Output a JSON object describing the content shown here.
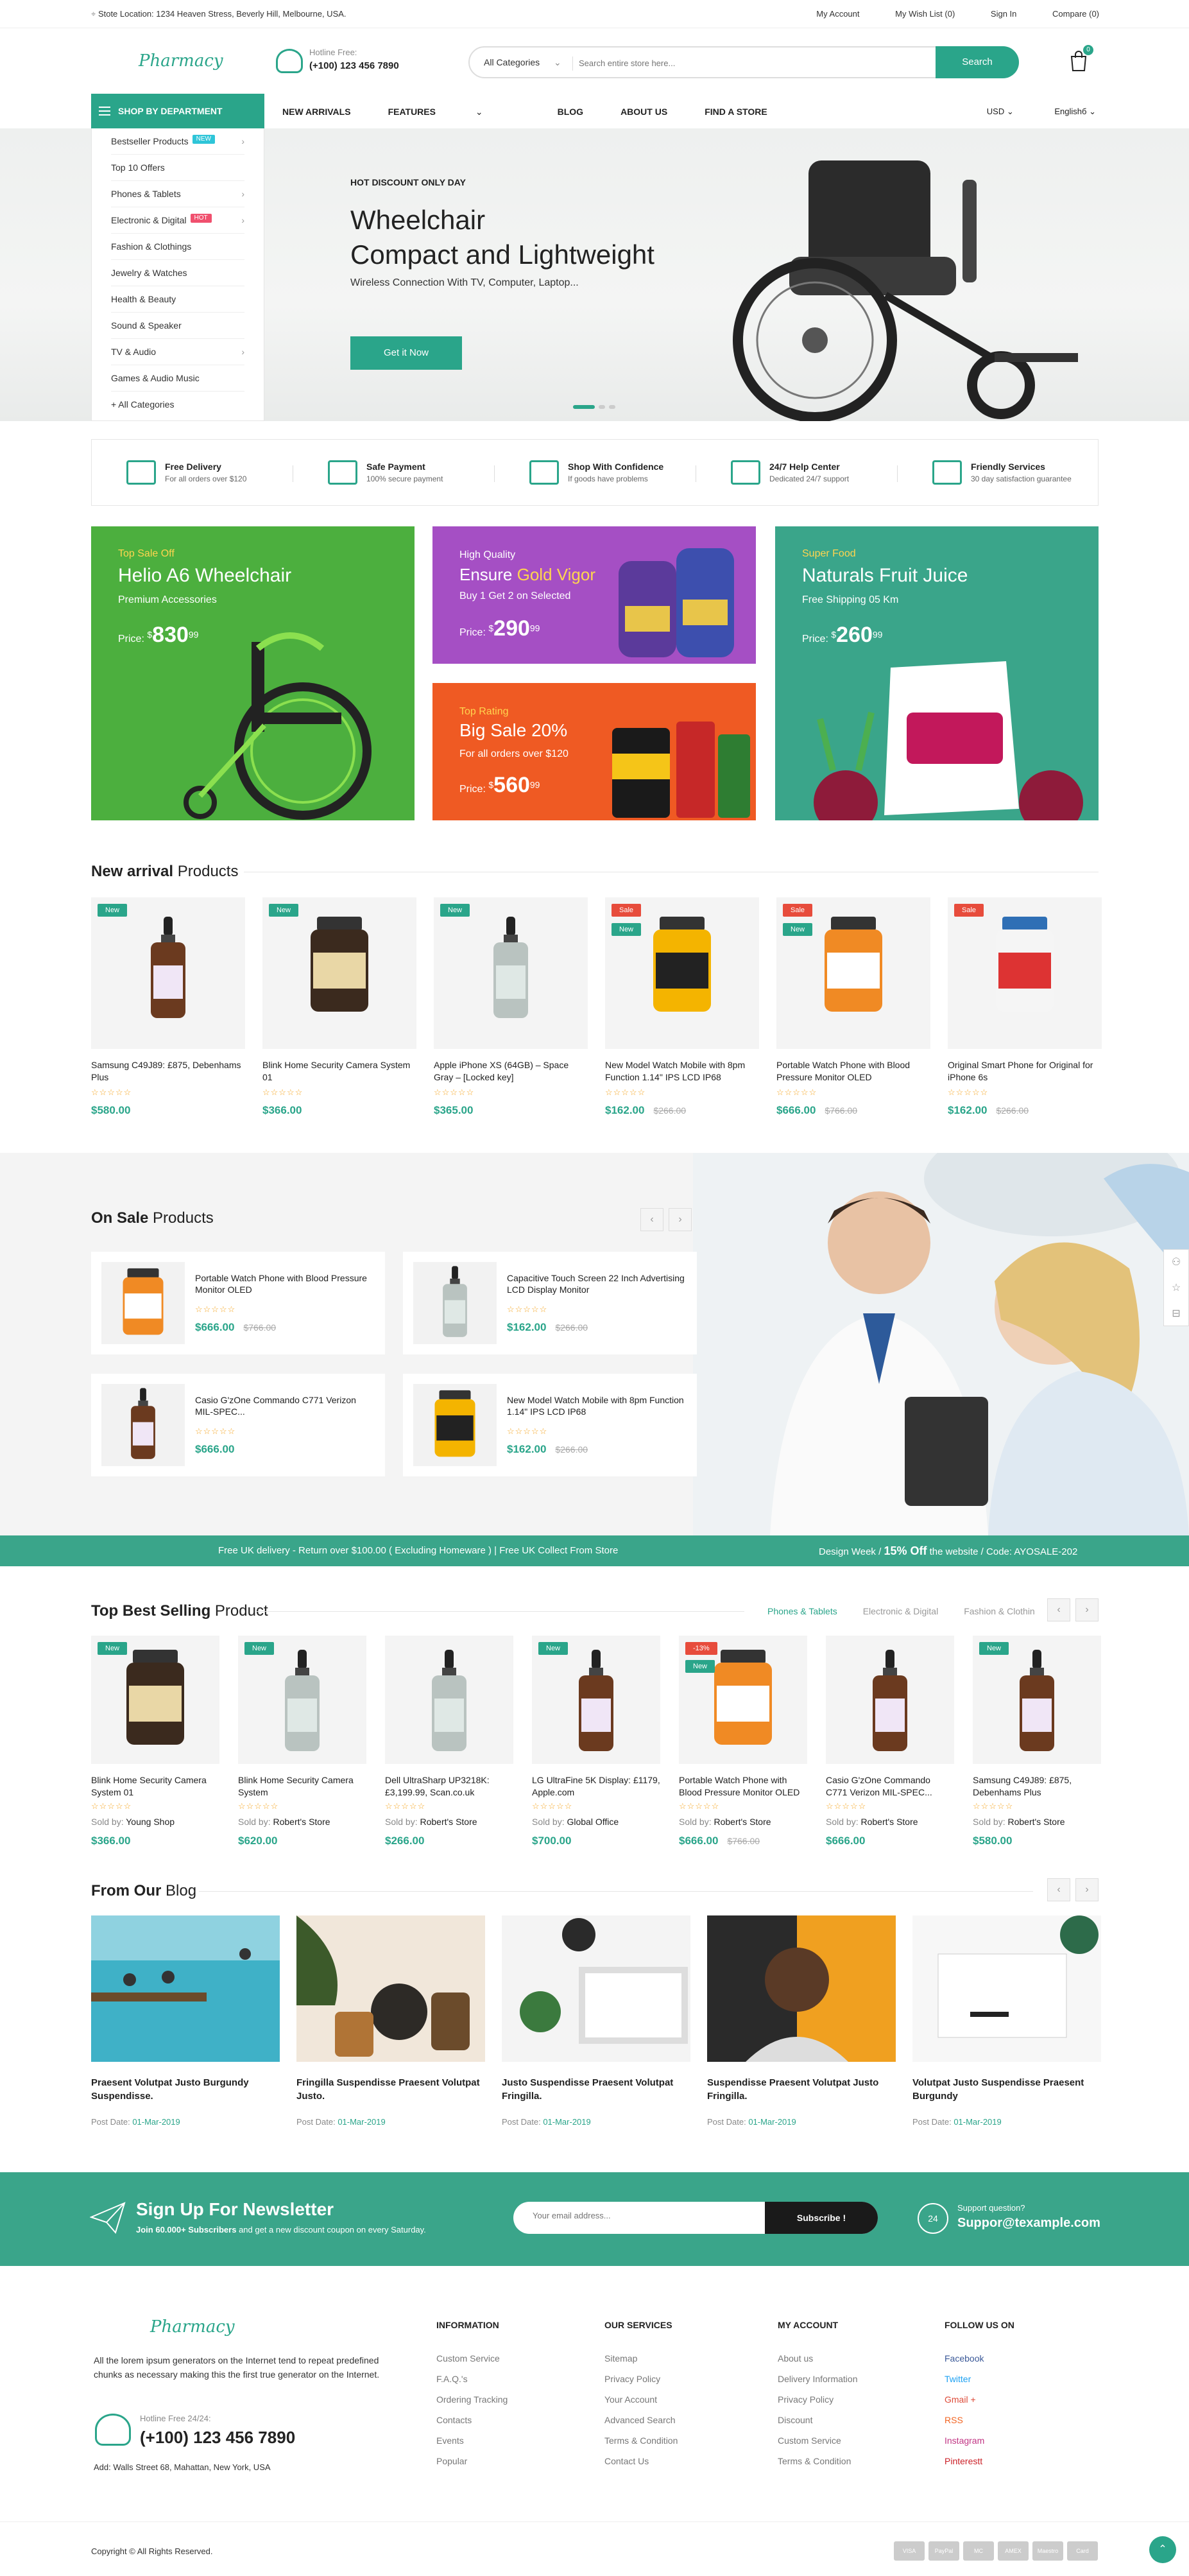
{
  "topbar": {
    "location": "Stote Location: 1234 Heaven Stress, Beverly Hill, Melbourne, USA.",
    "links": [
      "My Account",
      "My Wish List (0)",
      "Sign In",
      "Compare (0)"
    ]
  },
  "header": {
    "logo": "Pharmacy",
    "hotline_label": "Hotline Free:",
    "hotline_number": "(+100) 123 456 7890",
    "search_category": "All Categories",
    "search_placeholder": "Search entire store here...",
    "search_button": "Search",
    "cart_count": "0"
  },
  "nav": {
    "dept_label": "SHOP BY DEPARTMENT",
    "items": [
      "NEW ARRIVALS",
      "FEATURES",
      "BLOG",
      "ABOUT US",
      "FIND A STORE"
    ],
    "currency": "USD",
    "language": "Englishб"
  },
  "departments": [
    {
      "label": "Bestseller Products",
      "badge": "NEW",
      "badge_color": "#2ec5d8",
      "arrow": true
    },
    {
      "label": "Top 10 Offers",
      "badge": "",
      "arrow": false
    },
    {
      "label": "Phones & Tablets",
      "badge": "",
      "arrow": true
    },
    {
      "label": "Electronic & Digital",
      "badge": "HOT",
      "badge_color": "#f0506e",
      "arrow": true
    },
    {
      "label": "Fashion & Clothings",
      "badge": "",
      "arrow": false
    },
    {
      "label": "Jewelry & Watches",
      "badge": "",
      "arrow": false
    },
    {
      "label": "Health & Beauty",
      "badge": "",
      "arrow": false
    },
    {
      "label": "Sound & Speaker",
      "badge": "",
      "arrow": false
    },
    {
      "label": "TV & Audio",
      "badge": "",
      "arrow": true
    },
    {
      "label": "Games & Audio Music",
      "badge": "",
      "arrow": false
    },
    {
      "label": "+  All Categories",
      "badge": "",
      "arrow": false
    }
  ],
  "hero": {
    "kicker": "HOT DISCOUNT ONLY DAY",
    "title_line1": "Wheelchair",
    "title_line2": "Compact and Lightweight",
    "subtitle": "Wireless Connection With TV, Computer, Laptop...",
    "cta": "Get it Now"
  },
  "features": [
    {
      "title": "Free Delivery",
      "sub": "For all orders over $120",
      "icon": "free-truck-icon"
    },
    {
      "title": "Safe Payment",
      "sub": "100% secure payment",
      "icon": "card-icon"
    },
    {
      "title": "Shop With Confidence",
      "sub": "If goods have problems",
      "icon": "hand-icon"
    },
    {
      "title": "24/7 Help Center",
      "sub": "Dedicated 24/7 support",
      "icon": "chat-icon"
    },
    {
      "title": "Friendly Services",
      "sub": "30 day satisfaction guarantee",
      "icon": "id-card-icon"
    }
  ],
  "promos": {
    "p1": {
      "small": "Top Sale Off",
      "title": "Helio A6 Wheelchair",
      "sub": "Premium Accessories",
      "price_label": "Price:",
      "currency": "$",
      "price": "830",
      "cents": "99",
      "color": "#4caf3e"
    },
    "p2": {
      "small": "High Quality",
      "title_a": "Ensure ",
      "title_b": "Gold Vigor",
      "sub": "Buy 1 Get 2 on Selected",
      "price_label": "Price:",
      "currency": "$",
      "price": "290",
      "cents": "99",
      "color": "#a54fc4"
    },
    "p3": {
      "small": "Top Rating",
      "title": "Big Sale 20%",
      "sub": "For all orders over $120",
      "price_label": "Price:",
      "currency": "$",
      "price": "560",
      "cents": "99",
      "color": "#ef5a23"
    },
    "p4": {
      "small": "Super Food",
      "title": "Naturals Fruit Juice",
      "sub": "Free Shipping 05 Km",
      "price_label": "Price:",
      "currency": "$",
      "price": "260",
      "cents": "99",
      "color": "#3aa58a"
    }
  },
  "new_arrival": {
    "title_bold": "New arrival",
    "title_rest": " Products",
    "products": [
      {
        "name": "Samsung C49J89: £875, Debenhams Plus",
        "price": "$580.00",
        "old": "",
        "tags": [
          "New"
        ]
      },
      {
        "name": "Blink Home Security Camera System 01",
        "price": "$366.00",
        "old": "",
        "tags": [
          "New"
        ]
      },
      {
        "name": "Apple iPhone XS (64GB) – Space Gray – [Locked key]",
        "price": "$365.00",
        "old": "",
        "tags": [
          "New"
        ]
      },
      {
        "name": "New Model Watch Mobile with 8pm Function 1.14\" IPS LCD IP68",
        "price": "$162.00",
        "old": "$266.00",
        "tags": [
          "Sale",
          "New"
        ]
      },
      {
        "name": "Portable Watch Phone with Blood Pressure Monitor OLED",
        "price": "$666.00",
        "old": "$766.00",
        "tags": [
          "Sale",
          "New"
        ]
      },
      {
        "name": "Original Smart Phone for Original for iPhone 6s",
        "price": "$162.00",
        "old": "$266.00",
        "tags": [
          "Sale"
        ]
      }
    ]
  },
  "on_sale": {
    "title_bold": "On Sale",
    "title_rest": " Products",
    "products": [
      {
        "name": "Portable Watch Phone with Blood Pressure Monitor OLED",
        "price": "$666.00",
        "old": "$766.00"
      },
      {
        "name": "Capacitive Touch Screen 22 Inch Advertising LCD Display Monitor",
        "price": "$162.00",
        "old": "$266.00"
      },
      {
        "name": "Casio G'zOne Commando C771 Verizon MIL-SPEC...",
        "price": "$666.00",
        "old": ""
      },
      {
        "name": "New Model Watch Mobile with 8pm Function 1.14\" IPS LCD IP68",
        "price": "$162.00",
        "old": "$266.00"
      }
    ]
  },
  "ticker": {
    "left": "Free UK delivery - Return over $100.00 ( Excluding Homeware ) | Free UK Collect From Store",
    "right_a": "Design Week / ",
    "right_b": "15% Off",
    "right_c": " the website / Code: AYOSALE-202"
  },
  "best_selling": {
    "title_bold": "Top Best Selling",
    "title_rest": " Product",
    "tabs": [
      "Phones & Tablets",
      "Electronic & Digital",
      "Fashion & Clothin"
    ],
    "sold_by_label": "Sold by:",
    "products": [
      {
        "name": "Blink Home Security Camera System 01",
        "seller": "Young Shop",
        "price": "$366.00",
        "old": "",
        "tags": [
          "New"
        ]
      },
      {
        "name": "Blink Home Security Camera System",
        "seller": "Robert's Store",
        "price": "$620.00",
        "old": "",
        "tags": [
          "New"
        ]
      },
      {
        "name": "Dell UltraSharp UP3218K: £3,199.99, Scan.co.uk",
        "seller": "Robert's Store",
        "price": "$266.00",
        "old": "",
        "tags": []
      },
      {
        "name": "LG UltraFine 5K Display: £1179, Apple.com",
        "seller": "Global Office",
        "price": "$700.00",
        "old": "",
        "tags": [
          "New"
        ]
      },
      {
        "name": "Portable Watch Phone with Blood Pressure Monitor OLED",
        "seller": "Robert's Store",
        "price": "$666.00",
        "old": "$766.00",
        "tags": [
          "-13%",
          "New"
        ]
      },
      {
        "name": "Casio G'zOne Commando C771 Verizon MIL-SPEC...",
        "seller": "Robert's Store",
        "price": "$666.00",
        "old": "",
        "tags": []
      },
      {
        "name": "Samsung C49J89: £875, Debenhams Plus",
        "seller": "Robert's Store",
        "price": "$580.00",
        "old": "",
        "tags": [
          "New"
        ]
      }
    ]
  },
  "blog": {
    "title_bold": "From Our",
    "title_rest": " Blog",
    "date_label": "Post Date: ",
    "posts": [
      {
        "title": "Praesent Volutpat Justo Burgundy Suspendisse.",
        "date": "01-Mar-2019"
      },
      {
        "title": "Fringilla Suspendisse Praesent Volutpat Justo.",
        "date": "01-Mar-2019"
      },
      {
        "title": "Justo Suspendisse Praesent Volutpat Fringilla.",
        "date": "01-Mar-2019"
      },
      {
        "title": "Suspendisse Praesent Volutpat Justo Fringilla.",
        "date": "01-Mar-2019"
      },
      {
        "title": "Volutpat Justo Suspendisse Praesent Burgundy",
        "date": "01-Mar-2019"
      }
    ]
  },
  "newsletter": {
    "title": "Sign Up For Newsletter",
    "sub_bold": "Join 60.000+ Subscribers",
    "sub_rest": " and get a new discount coupon on every Saturday.",
    "placeholder": "Your email address...",
    "button": "Subscribe !",
    "support_label": "Support question?",
    "support_email": "Suppor@texample.com"
  },
  "footer": {
    "logo": "Pharmacy",
    "about": "All the lorem ipsum generators on the Internet tend to repeat predefined chunks as necessary making this the first true generator on the Internet.",
    "hotline_label": "Hotline Free 24/24:",
    "hotline_number": "(+100) 123 456 7890",
    "address": "Add: Walls Street 68, Mahattan, New York, USA",
    "columns": [
      {
        "title": "INFORMATION",
        "links": [
          "Custom Service",
          "F.A.Q.'s",
          "Ordering Tracking",
          "Contacts",
          "Events",
          "Popular"
        ]
      },
      {
        "title": "OUR SERVICES",
        "links": [
          "Sitemap",
          "Privacy Policy",
          "Your Account",
          "Advanced Search",
          "Terms & Condition",
          "Contact Us"
        ]
      },
      {
        "title": "MY ACCOUNT",
        "links": [
          "About us",
          "Delivery Information",
          "Privacy Policy",
          "Discount",
          "Custom Service",
          "Terms & Condition"
        ]
      }
    ],
    "follow_title": "FOLLOW US ON",
    "social": [
      {
        "label": "Facebook",
        "color": "#3b5998"
      },
      {
        "label": "Twitter",
        "color": "#1da1f2"
      },
      {
        "label": "Gmail +",
        "color": "#dd4b39"
      },
      {
        "label": "RSS",
        "color": "#f26522"
      },
      {
        "label": "Instagram",
        "color": "#c13584"
      },
      {
        "label": "Pinterestt",
        "color": "#cb2027"
      }
    ],
    "copyright": "Copyright ©  All Rights Reserved.",
    "payments": [
      "VISA",
      "PayPal",
      "MC",
      "AMEX",
      "Maestro",
      "Card"
    ]
  }
}
